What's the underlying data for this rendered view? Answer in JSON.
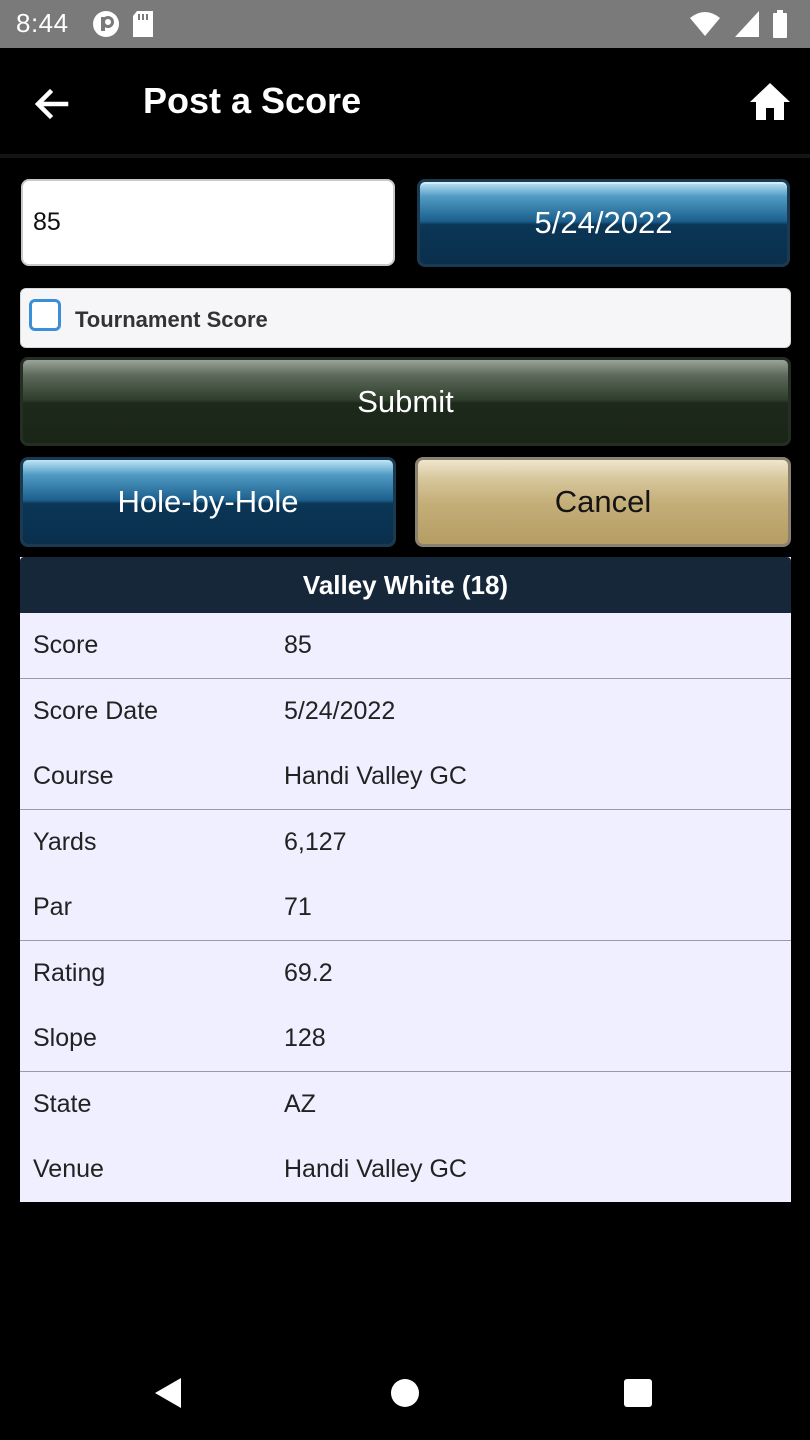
{
  "status_bar": {
    "time": "8:44",
    "icons": [
      "privacy-icon",
      "sd-card-icon",
      "wifi-icon",
      "signal-icon",
      "battery-icon"
    ]
  },
  "app_bar": {
    "title": "Post a Score",
    "back_icon": "back-arrow-icon",
    "home_icon": "home-icon"
  },
  "form": {
    "score_value": "85",
    "date_label": "5/24/2022",
    "tournament_label": "Tournament Score",
    "tournament_checked": false,
    "submit_label": "Submit",
    "hole_by_hole_label": "Hole-by-Hole",
    "cancel_label": "Cancel"
  },
  "details": {
    "header": "Valley White (18)",
    "groups": [
      [
        {
          "key": "Score",
          "value": "85"
        }
      ],
      [
        {
          "key": "Score Date",
          "value": "5/24/2022"
        },
        {
          "key": "Course",
          "value": "Handi Valley GC"
        }
      ],
      [
        {
          "key": "Yards",
          "value": "6,127"
        },
        {
          "key": "Par",
          "value": "71"
        }
      ],
      [
        {
          "key": "Rating",
          "value": "69.2"
        },
        {
          "key": "Slope",
          "value": "128"
        }
      ],
      [
        {
          "key": "State",
          "value": "AZ"
        },
        {
          "key": "Venue",
          "value": "Handi Valley GC"
        }
      ]
    ]
  },
  "colors": {
    "header_bg": "#16273a",
    "details_bg": "#efefff",
    "checkbox_accent": "#3a8fd6"
  },
  "nav_bar": {
    "icons": [
      "nav-back-icon",
      "nav-home-icon",
      "nav-recents-icon"
    ]
  }
}
